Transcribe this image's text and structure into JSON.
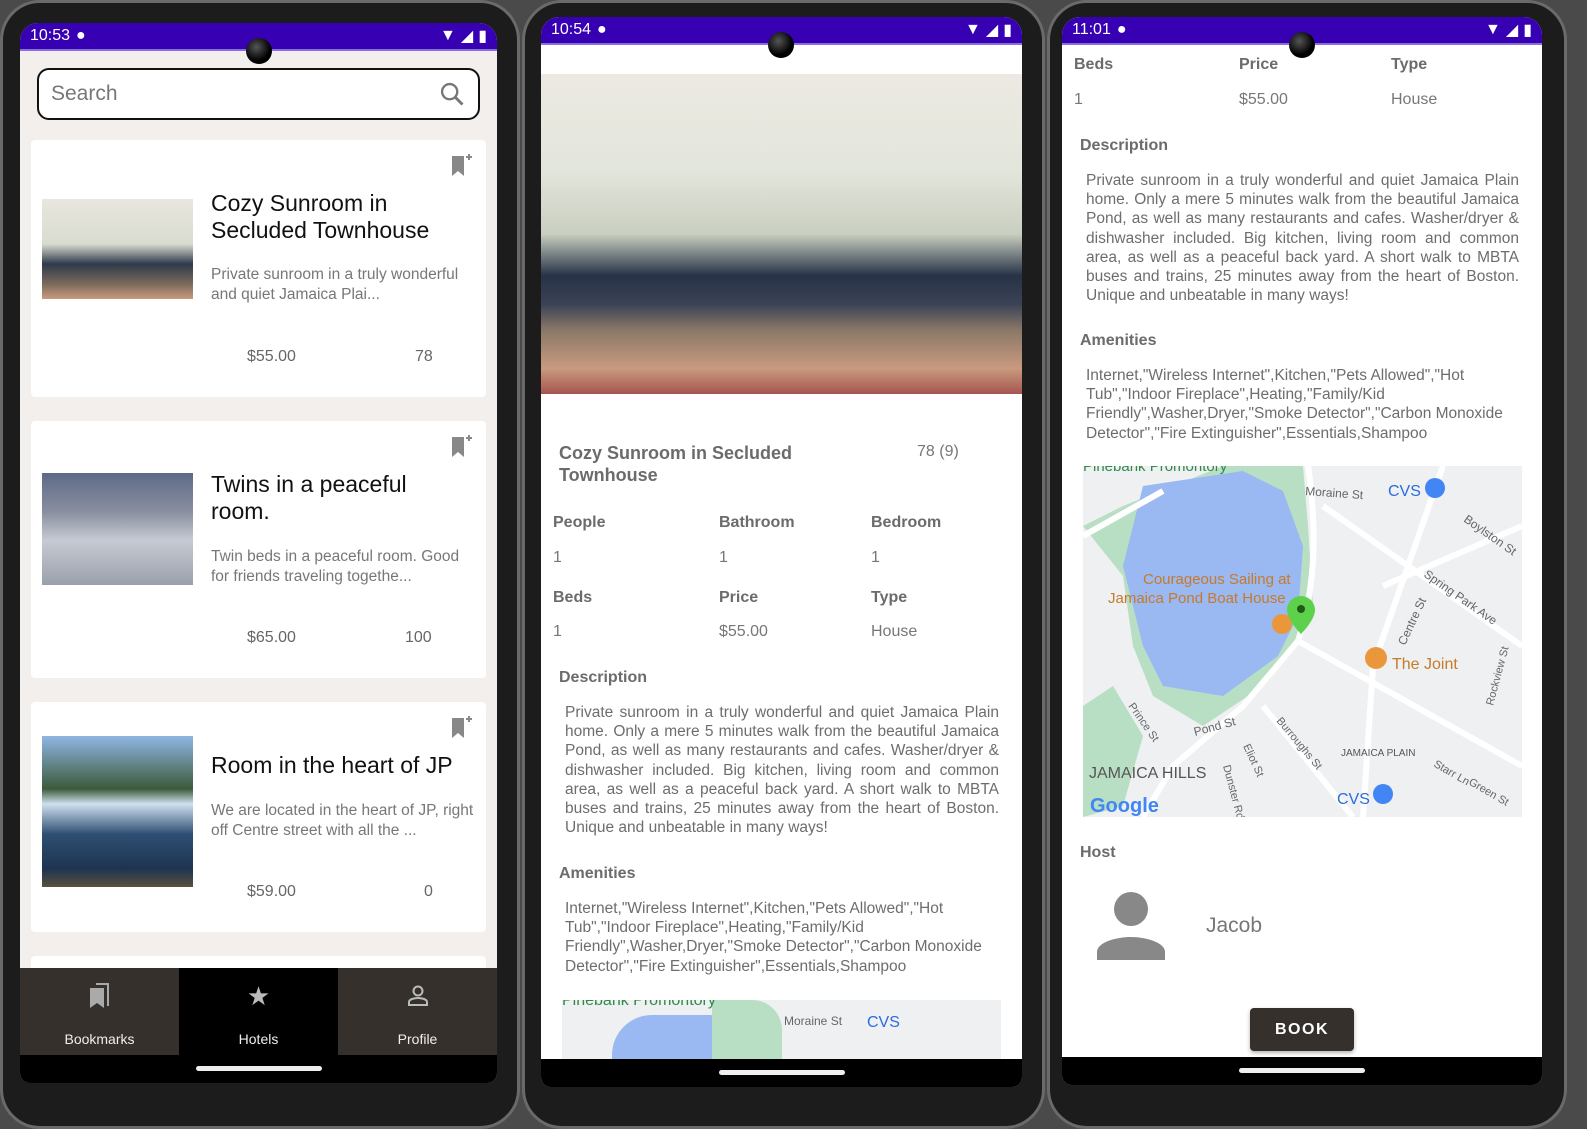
{
  "colors": {
    "status_bar": "#3700b3",
    "nav_bg": "#35302b",
    "nav_active": "#000000",
    "list_bg": "#f2efec",
    "book_button": "#35302b",
    "map_water": "#9ab8f2",
    "map_park": "#b8dfc4",
    "map_pin": "#5ed14c",
    "poi_food": "#e9973a",
    "poi_shop": "#4285f4"
  },
  "list_screen": {
    "status": {
      "time": "10:53"
    },
    "search": {
      "placeholder": "Search",
      "icon": "search-icon"
    },
    "hotels": [
      {
        "title": "Cozy Sunroom in Secluded Townhouse",
        "description": "Private sunroom in a truly wonderful and quiet Jamaica Plai...",
        "price": "$55.00",
        "rating": "78",
        "image": "sunroom-photo"
      },
      {
        "title": "Twins in a peaceful room.",
        "description": "Twin beds in a peaceful room. Good for friends traveling togethe...",
        "price": "$65.00",
        "rating": "100",
        "image": "twin-bedroom-photo"
      },
      {
        "title": "Room in the heart of JP",
        "description": "We are located in the heart of JP, right off Centre street with all the ...",
        "price": "$59.00",
        "rating": "0",
        "image": "pond-photo"
      }
    ],
    "nav": [
      {
        "label": "Bookmarks",
        "icon": "bookmarks-icon",
        "active": false
      },
      {
        "label": "Hotels",
        "icon": "star-icon",
        "active": true
      },
      {
        "label": "Profile",
        "icon": "person-icon",
        "active": false
      }
    ]
  },
  "detail": {
    "status_top": {
      "time": "10:54"
    },
    "status_bottom": {
      "time": "11:01"
    },
    "title": "Cozy Sunroom in Secluded Townhouse",
    "rating": "78 (9)",
    "fields": [
      {
        "label": "People",
        "value": "1"
      },
      {
        "label": "Bathroom",
        "value": "1"
      },
      {
        "label": "Bedroom",
        "value": "1"
      },
      {
        "label": "Beds",
        "value": "1"
      },
      {
        "label": "Price",
        "value": "$55.00"
      },
      {
        "label": "Type",
        "value": "House"
      }
    ],
    "description_label": "Description",
    "description": "Private sunroom in a truly wonderful and quiet Jamaica Plain home. Only a mere 5 minutes walk from the beautiful Jamaica Pond, as well as many restaurants and cafes. Washer/dryer & dishwasher included. Big kitchen, living room and common area, as well as a peaceful back yard. A short walk to MBTA buses and trains, 25 minutes away from the heart of Boston. Unique and unbeatable in many ways!",
    "amenities_label": "Amenities",
    "amenities": "Internet,\"Wireless Internet\",Kitchen,\"Pets Allowed\",\"Hot Tub\",\"Indoor Fireplace\",Heating,\"Family/Kid Friendly\",Washer,Dryer,\"Smoke Detector\",\"Carbon Monoxide Detector\",\"Fire Extinguisher\",Essentials,Shampoo",
    "map": {
      "labels": {
        "park": "Pinebank Promontory",
        "moraine": "Moraine St",
        "cvs": "CVS",
        "boylston": "Boylston St",
        "courageous1": "Courageous Sailing at",
        "courageous2": "Jamaica Pond Boat House",
        "spring": "Spring Park Ave",
        "centre": "Centre St",
        "joint": "The Joint",
        "rockview": "Rockview St",
        "prince": "Prince St",
        "pond": "Pond St",
        "burroughs": "Burroughs St",
        "eliot": "Eliot St",
        "dunster": "Dunster Rd",
        "jp": "JAMAICA PLAIN",
        "jh": "JAMAICA HILLS",
        "starr": "Starr Ln",
        "green": "Green St",
        "google": "Google"
      }
    },
    "host_label": "Host",
    "host_name": "Jacob",
    "book_label": "BOOK"
  }
}
